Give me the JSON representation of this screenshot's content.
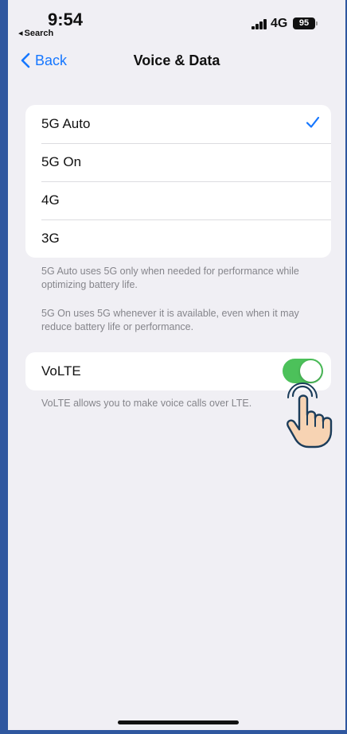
{
  "status_bar": {
    "time": "9:54",
    "back_app": "Search",
    "network": "4G",
    "battery": "95"
  },
  "nav": {
    "back_label": "Back",
    "title": "Voice & Data"
  },
  "options": {
    "items": [
      {
        "label": "5G Auto",
        "selected": true
      },
      {
        "label": "5G On",
        "selected": false
      },
      {
        "label": "4G",
        "selected": false
      },
      {
        "label": "3G",
        "selected": false
      }
    ],
    "footnote_1": "5G Auto uses 5G only when needed for performance while optimizing battery life.",
    "footnote_2": "5G On uses 5G whenever it is available, even when it may reduce battery life or performance."
  },
  "volte": {
    "label": "VoLTE",
    "enabled": true,
    "footnote": "VoLTE allows you to make voice calls over LTE."
  },
  "colors": {
    "accent": "#1677ff",
    "toggle_on": "#4cc15a",
    "background": "#f0eff4",
    "frame": "#2f579f"
  }
}
